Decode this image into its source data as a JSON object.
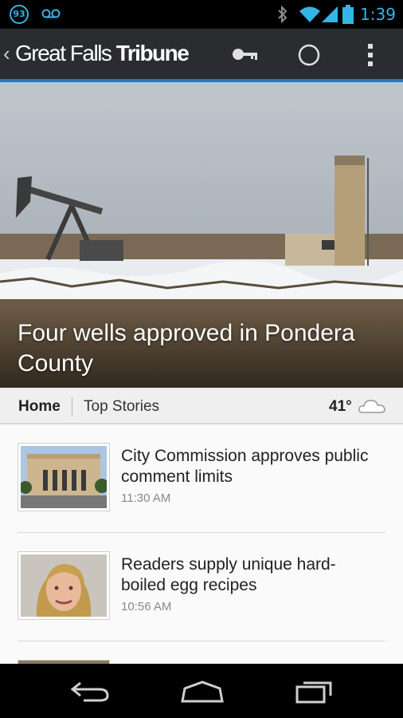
{
  "status_bar": {
    "notification_count": "93",
    "time": "1:39",
    "icons": [
      "voicemail-icon",
      "bluetooth-icon",
      "wifi-icon",
      "cell-signal-icon",
      "battery-icon"
    ],
    "accent_color": "#33b5e5"
  },
  "app_bar": {
    "brand_part1": "Great Falls ",
    "brand_part2": "Tribune",
    "actions": [
      "key-icon",
      "refresh-circle-icon",
      "overflow-menu-icon"
    ],
    "underline_color": "#1f79c7"
  },
  "hero": {
    "title": "Four wells approved in Pondera County"
  },
  "section_bar": {
    "tab_home": "Home",
    "tab_top_stories": "Top Stories",
    "temperature": "41°",
    "weather_icon": "cloud-icon"
  },
  "articles": [
    {
      "headline": "City Commission approves public comment limits",
      "time": "11:30 AM",
      "thumb": "building-photo"
    },
    {
      "headline": "Readers supply unique hard-boiled egg recipes",
      "time": "10:56 AM",
      "thumb": "person-photo"
    }
  ],
  "nav_bar": {
    "buttons": [
      "back-icon",
      "home-icon",
      "recents-icon"
    ]
  }
}
